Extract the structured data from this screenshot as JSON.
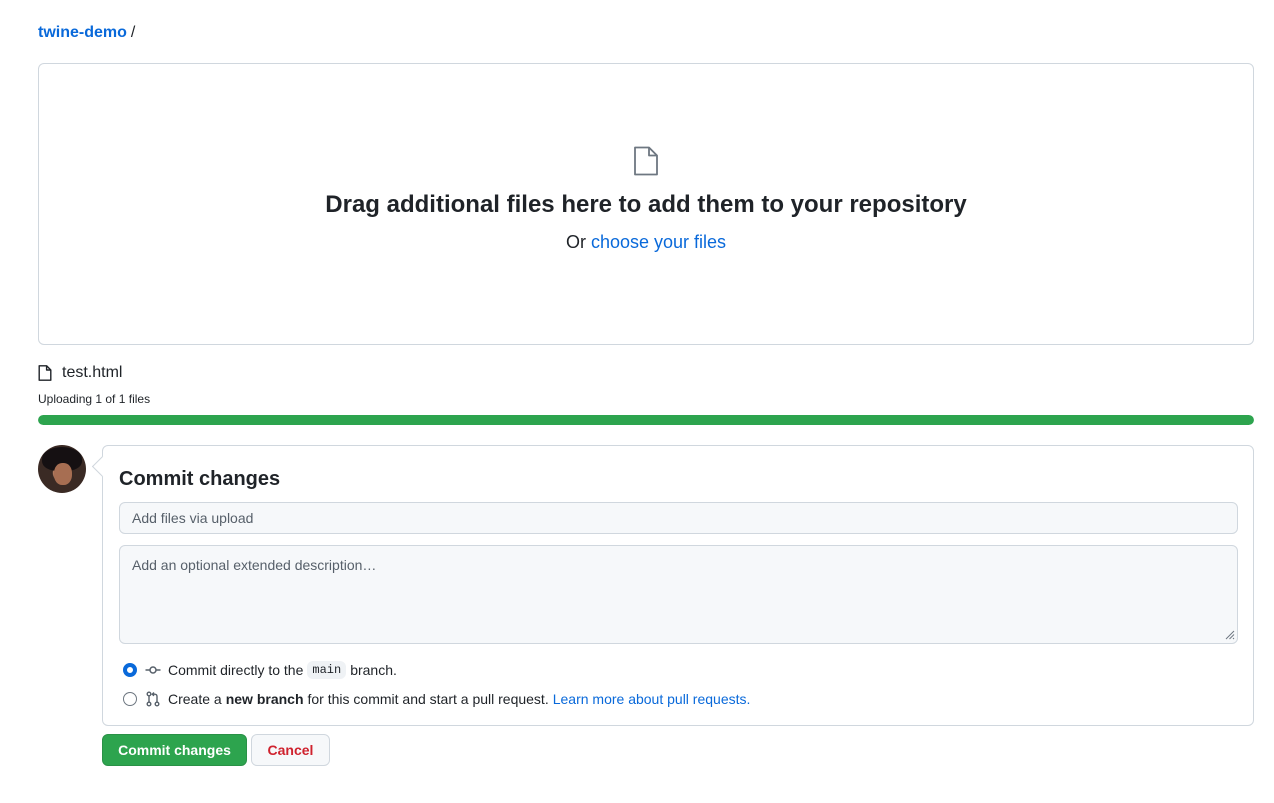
{
  "breadcrumb": {
    "repo": "twine-demo",
    "separator": "/"
  },
  "dropzone": {
    "icon": "file-icon",
    "title": "Drag additional files here to add them to your repository",
    "sub_prefix": "Or",
    "sub_link": "choose your files"
  },
  "upload": {
    "file_name": "test.html",
    "status": "Uploading 1 of 1 files",
    "progress_percent": 100,
    "progress_color": "#2da44e"
  },
  "commit": {
    "heading": "Commit changes",
    "summary_placeholder": "Add files via upload",
    "description_placeholder": "Add an optional extended description…",
    "option_direct": {
      "prefix": "Commit directly to the",
      "branch": "main",
      "suffix": "branch.",
      "selected": true
    },
    "option_new_branch": {
      "prefix": "Create a",
      "bold": "new branch",
      "suffix": "for this commit and start a pull request.",
      "link": "Learn more about pull requests.",
      "selected": false
    },
    "submit_label": "Commit changes",
    "cancel_label": "Cancel"
  },
  "colors": {
    "link": "#0969da",
    "primary": "#2da44e",
    "danger": "#cf222e",
    "border": "#d0d7de"
  }
}
